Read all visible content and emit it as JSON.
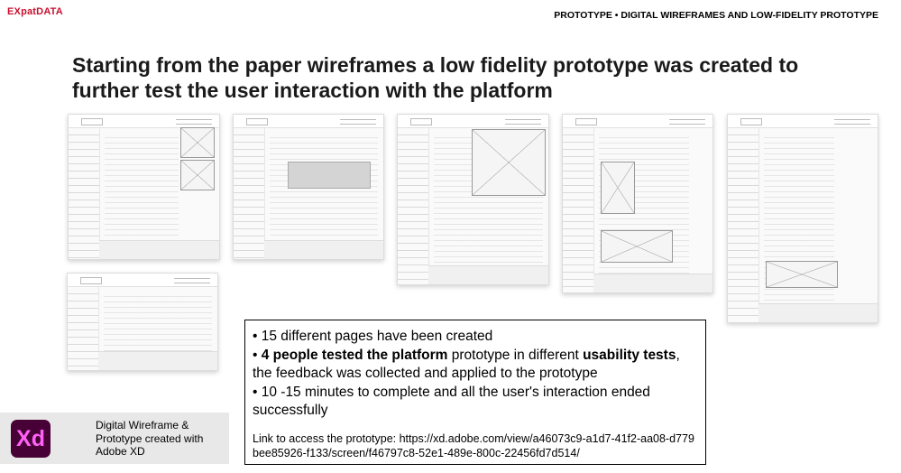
{
  "brand": {
    "logo": "EXpatDATA",
    "accent": "#c8102e"
  },
  "header": {
    "section": "PROTOTYPE • DIGITAL WIREFRAMES AND LOW-FIDELITY PROTOTYPE"
  },
  "title": "Starting from the paper wireframes a low fidelity prototype was created to further test the user interaction with the platform",
  "thumbnails": [
    {
      "name": "wireframe-quiz-page"
    },
    {
      "name": "wireframe-form-overlay"
    },
    {
      "name": "wireframe-sitemap"
    },
    {
      "name": "wireframe-article-traditions"
    },
    {
      "name": "wireframe-article-where-to-live"
    },
    {
      "name": "wireframe-contact-page"
    }
  ],
  "info": {
    "b1": "• 15 different pages have been created",
    "b2_prefix": "• ",
    "b2_bold1": "4 people tested the platform",
    "b2_mid": " prototype in different ",
    "b2_bold2": "usability tests",
    "b2_suffix": ", the feedback was collected and applied to the prototype",
    "b3": "• 10 -15 minutes to complete and all the user's interaction ended successfully",
    "link": "Link to access the prototype: https://xd.adobe.com/view/a46073c9-a1d7-41f2-aa08-d779bee85926-f133/screen/f46797c8-52e1-489e-800c-22456fd7d514/"
  },
  "tool": {
    "icon_label": "Xd",
    "icon_name": "adobe-xd-icon",
    "caption": "Digital Wireframe & Prototype created with Adobe XD"
  }
}
